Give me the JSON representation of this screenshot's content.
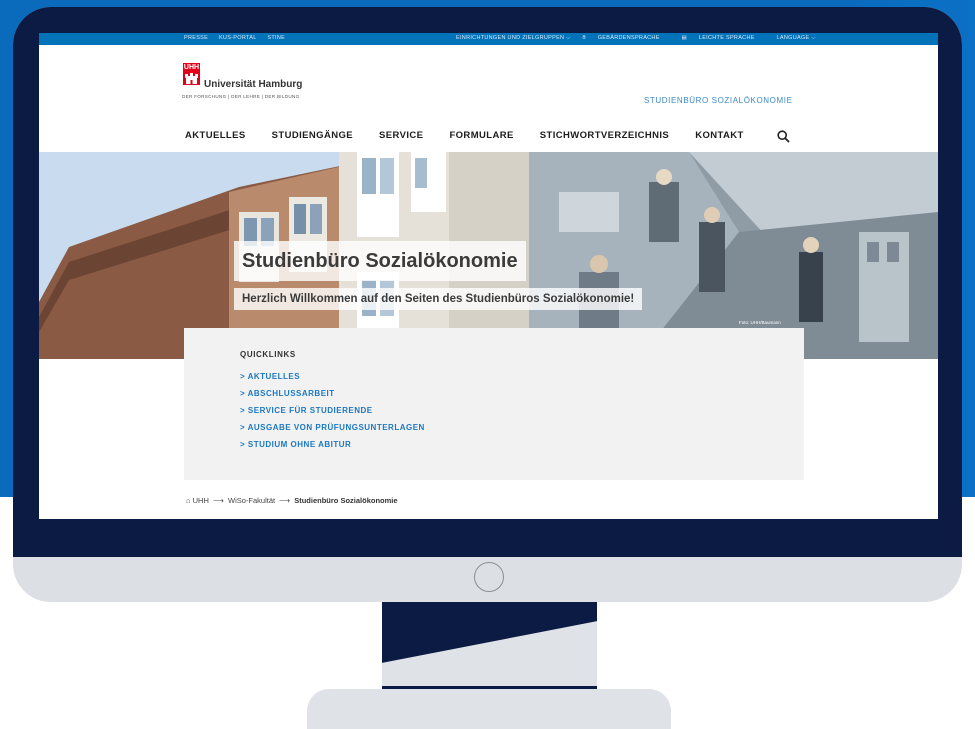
{
  "topbar": {
    "left_links": [
      "PRESSE",
      "KUS-PORTAL",
      "STINE"
    ],
    "right_links": [
      "EINRICHTUNGEN UND ZIELGRUPPEN ⌵",
      "GEBÄRDENSPRACHE",
      "LEICHTE SPRACHE",
      "LANGUAGE ⌵"
    ]
  },
  "header": {
    "logo_text": "UHH",
    "university": "Universität Hamburg",
    "tagline": "DER FORSCHUNG | DER LEHRE | DER BILDUNG",
    "site_name": "STUDIENBÜRO SOZIALÖKONOMIE"
  },
  "nav": {
    "items": [
      "AKTUELLES",
      "STUDIENGÄNGE",
      "SERVICE",
      "FORMULARE",
      "STICHWORTVERZEICHNIS",
      "KONTAKT"
    ]
  },
  "hero": {
    "title": "Studienbüro Sozialökonomie",
    "subtitle": "Herzlich Willkommen auf den Seiten des Studienbüros Sozialökonomie!",
    "credit": "Foto: UHH/Baumann"
  },
  "quicklinks": {
    "title": "QUICKLINKS",
    "items": [
      "> AKTUELLES",
      "> ABSCHLUSSARBEIT",
      "> SERVICE FÜR STUDIERENDE",
      "> AUSGABE VON PRÜFUNGSUNTERLAGEN",
      "> STUDIUM OHNE ABITUR"
    ]
  },
  "breadcrumb": {
    "items": [
      "UHH",
      "WiSo-Fakultät",
      "Studienbüro Sozialökonomie"
    ],
    "separator": "⟶"
  },
  "colors": {
    "background_blue": "#0a6bbd",
    "monitor_dark": "#0c1b44",
    "monitor_silver": "#dcdfe3",
    "topbar_blue": "#0272b9",
    "uhh_red": "#e2001a",
    "link_blue": "#1b78c2"
  }
}
